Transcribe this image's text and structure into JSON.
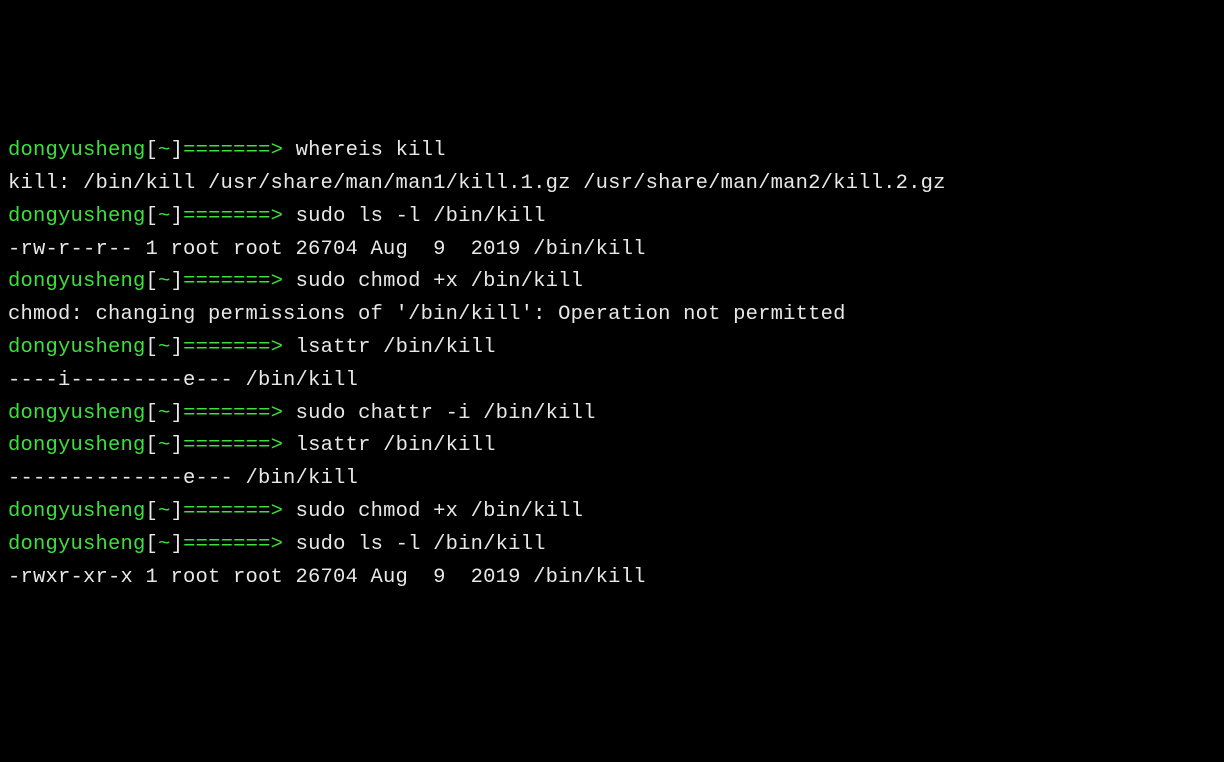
{
  "prompt": {
    "user": "dongyusheng",
    "lbracket": "[",
    "cwd": "~",
    "rbracket": "]",
    "arrow": "=======> "
  },
  "lines": [
    {
      "type": "prompt",
      "cmd": "whereis kill"
    },
    {
      "type": "output",
      "text": "kill: /bin/kill /usr/share/man/man1/kill.1.gz /usr/share/man/man2/kill.2.gz"
    },
    {
      "type": "prompt",
      "cmd": "sudo ls -l /bin/kill"
    },
    {
      "type": "output",
      "text": "-rw-r--r-- 1 root root 26704 Aug  9  2019 /bin/kill"
    },
    {
      "type": "prompt",
      "cmd": "sudo chmod +x /bin/kill"
    },
    {
      "type": "output",
      "text": "chmod: changing permissions of '/bin/kill': Operation not permitted"
    },
    {
      "type": "prompt",
      "cmd": "lsattr /bin/kill"
    },
    {
      "type": "output",
      "text": "----i---------e--- /bin/kill"
    },
    {
      "type": "prompt",
      "cmd": "sudo chattr -i /bin/kill"
    },
    {
      "type": "prompt",
      "cmd": "lsattr /bin/kill"
    },
    {
      "type": "output",
      "text": "--------------e--- /bin/kill"
    },
    {
      "type": "prompt",
      "cmd": "sudo chmod +x /bin/kill"
    },
    {
      "type": "prompt",
      "cmd": "sudo ls -l /bin/kill"
    },
    {
      "type": "output",
      "text": "-rwxr-xr-x 1 root root 26704 Aug  9  2019 /bin/kill"
    }
  ]
}
